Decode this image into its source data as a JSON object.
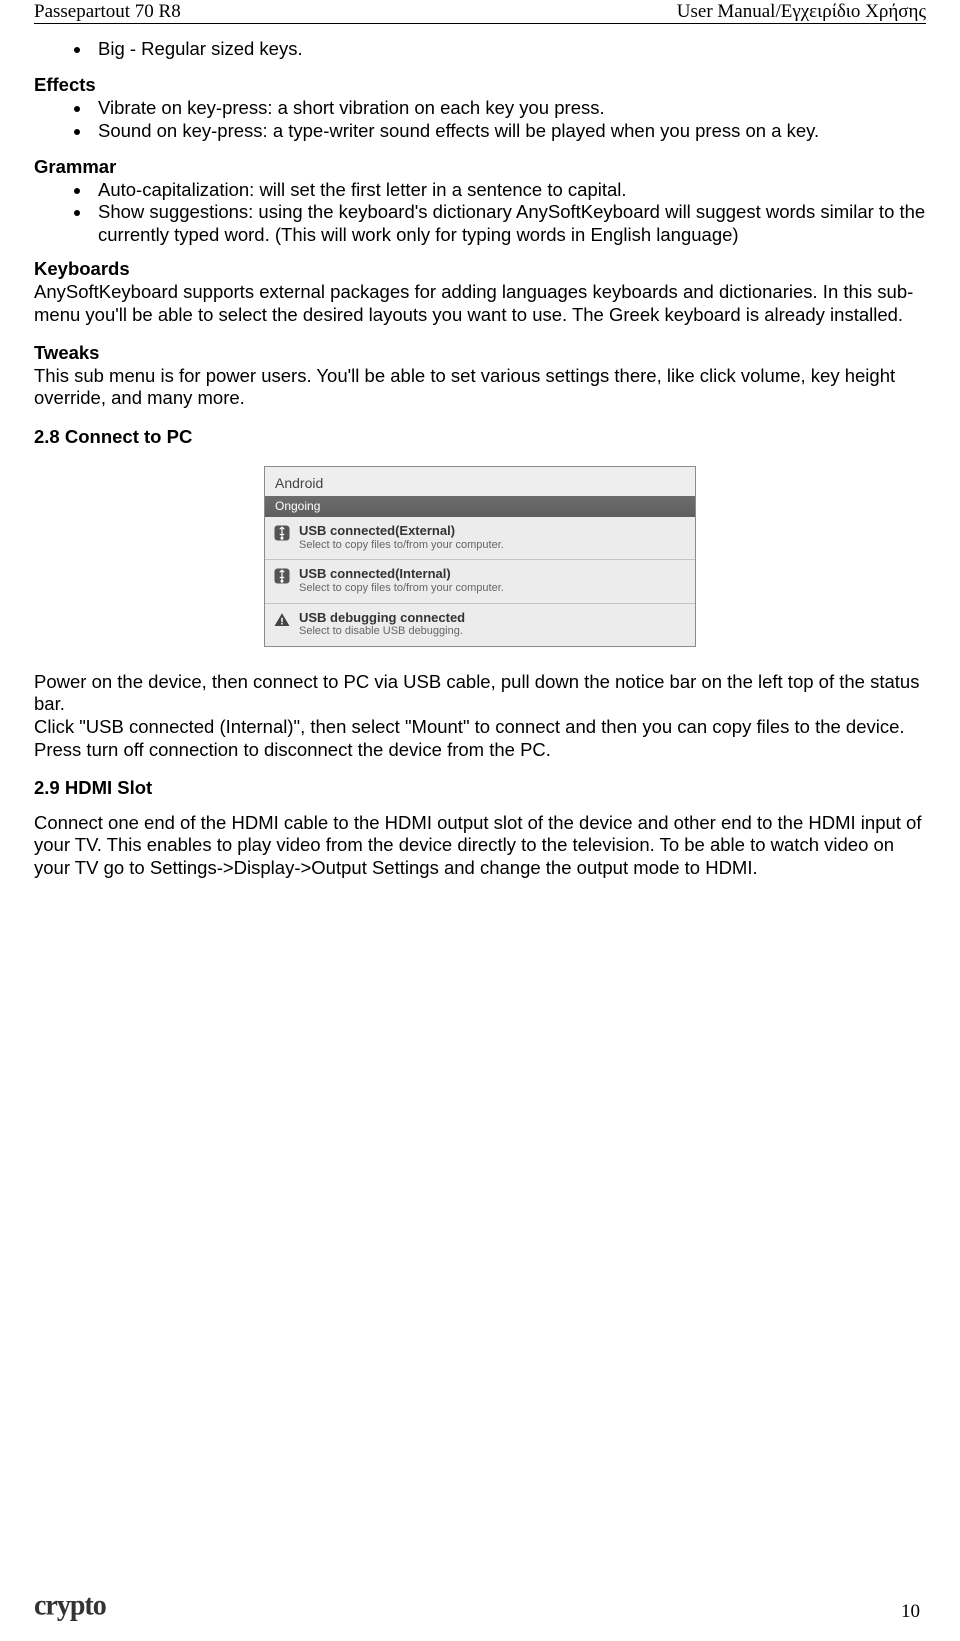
{
  "header": {
    "left": "Passepartout 70 R8",
    "right": "User Manual/Εγχειρίδιο Χρήσης"
  },
  "bigBullet": "Big - Regular sized keys.",
  "effects": {
    "title": "Effects",
    "bullets": [
      "Vibrate on key-press: a short vibration on each key you press.",
      "Sound on key-press: a type-writer sound effects will be played when you press on a key."
    ]
  },
  "grammar": {
    "title": "Grammar",
    "bullets": [
      "Auto-capitalization: will set the first letter in a sentence to capital.",
      "Show suggestions: using the keyboard's dictionary AnySoftKeyboard will suggest words similar to the currently typed word. (This will work only for typing words in English language)"
    ]
  },
  "keyboards": {
    "title": "Keyboards",
    "body": "AnySoftKeyboard supports external packages for adding languages keyboards and dictionaries. In this sub-menu you'll be able to select the desired layouts you want to use. The Greek keyboard is already installed."
  },
  "tweaks": {
    "title": "Tweaks",
    "body": "This sub menu is for power users. You'll be able to set various settings there, like click volume, key height override, and many more."
  },
  "section28": "2.8 Connect to PC",
  "notif": {
    "platform": "Android",
    "band": "Ongoing",
    "rows": [
      {
        "title": "USB connected(External)",
        "sub": "Select to copy files to/from your computer."
      },
      {
        "title": "USB connected(Internal)",
        "sub": "Select to copy files to/from your computer."
      },
      {
        "title": "USB debugging connected",
        "sub": "Select to disable USB debugging."
      }
    ]
  },
  "connectBody": "Power on the device, then connect to PC via USB cable, pull down the notice bar on the left top of the status bar.\nClick \"USB connected (Internal)\", then select \"Mount\" to connect and then you can copy files to the device. Press turn off connection to disconnect the device from the PC.",
  "section29": "2.9 HDMI Slot",
  "hdmiBody": "Connect one end of the HDMI cable to the  HDMI output slot of the device and other end to the HDMI input of your TV. This enables to play video from the device directly to the television. To be able to watch video on your TV go to Settings->Display->Output Settings and change the output mode to HDMI.",
  "footer": {
    "logo": "crypto",
    "page": "10"
  }
}
